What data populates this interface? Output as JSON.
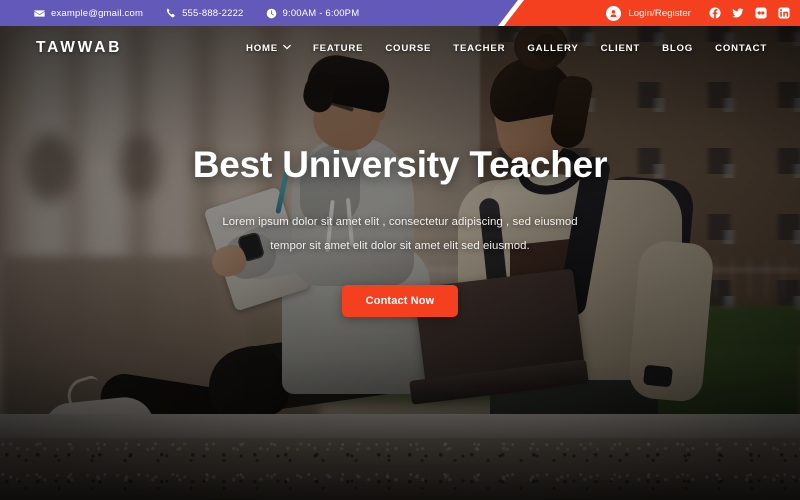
{
  "topbar": {
    "email": "example@gmail.com",
    "phone": "555-888-2222",
    "hours": "9:00AM - 6:00PM",
    "login_label": "Login/Register",
    "socials": [
      {
        "name": "facebook-icon",
        "label": "Facebook"
      },
      {
        "name": "twitter-icon",
        "label": "Twitter"
      },
      {
        "name": "flickr-icon",
        "label": "Flickr"
      },
      {
        "name": "linkedin-icon",
        "label": "LinkedIn"
      }
    ],
    "purple_color": "#6259b8",
    "red_color": "#f4401f"
  },
  "nav": {
    "logo": "TAWWAB",
    "items": [
      {
        "label": "HOME",
        "has_dropdown": true
      },
      {
        "label": "FEATURE",
        "has_dropdown": false
      },
      {
        "label": "COURSE",
        "has_dropdown": false
      },
      {
        "label": "TEACHER",
        "has_dropdown": false
      },
      {
        "label": "GALLERY",
        "has_dropdown": false
      },
      {
        "label": "CLIENT",
        "has_dropdown": false
      },
      {
        "label": "BLOG",
        "has_dropdown": false
      },
      {
        "label": "CONTACT",
        "has_dropdown": false
      }
    ]
  },
  "hero": {
    "title": "Best University Teacher",
    "subtitle_line1": "Lorem ipsum dolor sit amet elit , consectetur adipiscing , sed eiusmod",
    "subtitle_line2": "tempor sit amet elit dolor sit amet elit sed eiusmod.",
    "cta_label": "Contact Now",
    "cta_color": "#f4401f"
  }
}
